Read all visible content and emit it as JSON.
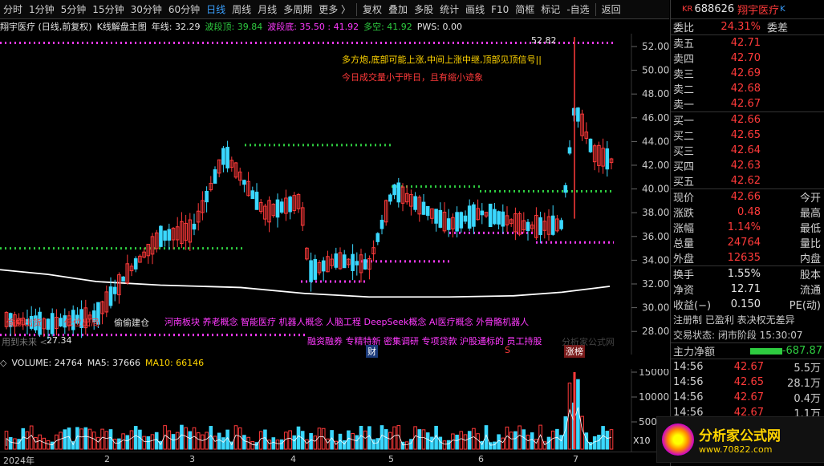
{
  "toolbar": {
    "items": [
      "分时",
      "1分钟",
      "5分钟",
      "15分钟",
      "30分钟",
      "60分钟",
      "日线",
      "周线",
      "月线",
      "多周期",
      "更多 〉",
      "复权",
      "叠加",
      "多股",
      "统计",
      "画线",
      "F10",
      "简框",
      "标记",
      "-自选",
      "返回"
    ]
  },
  "info": {
    "name": "翔宇医疗 (日线,前复权)",
    "indicator": "K线解盘主图",
    "ma_year": "年线: 32.29",
    "wave_top": "波段顶: 39.84",
    "wave_bottom": "波段底: 35.50 : 41.92",
    "longshort": "多空: 41.92",
    "pws": "PWS: 0.00"
  },
  "price_axis": [
    "52.00",
    "50.00",
    "48.00",
    "46.00",
    "44.00",
    "42.00",
    "40.00",
    "38.00",
    "36.00",
    "34.00",
    "32.00",
    "30.00",
    "28.00"
  ],
  "annotations": {
    "peak": "52.82",
    "low": "27.34",
    "signal1": "多方炮,底部可能上涨,中间上涨中继,顶部见顶信号||",
    "signal2": "今日成交量小于昨日，且有缩小迹象",
    "concepts1": "河南板块  养老概念  智能医疗  机器人概念  人脑工程  DeepSeek概念  AI医疗概念  外骨骼机器人",
    "concepts2": "融资融券  专精特新  密集调研  专项贷款  沪股通标的  员工持股",
    "left_tags": "偷偷出货",
    "left_tags2": "低位出局",
    "left_tags3": "偷偷建仓",
    "cai": "财",
    "s": "S",
    "zhangbang": "涨榜",
    "watermark": "用到未来 <",
    "watermark2": "分析家公式网"
  },
  "volume_info": {
    "vol": "VOLUME: 24764",
    "ma5": "MA5: 37666",
    "ma10": "MA10: 66146"
  },
  "vol_axis": [
    "15000",
    "10000",
    "5000"
  ],
  "vol_unit": "X10",
  "date_axis": [
    "2024年",
    "2",
    "3",
    "4",
    "5",
    "6",
    "7"
  ],
  "right_panel": {
    "code": "688626",
    "name": "翔宇医疗",
    "prefix": "KR",
    "suffix": "K",
    "weibi_label": "委比",
    "weibi_value": "24.31%",
    "weicha_label": "委差",
    "asks": [
      {
        "label": "卖五",
        "price": "42.71"
      },
      {
        "label": "卖四",
        "price": "42.70"
      },
      {
        "label": "卖三",
        "price": "42.69"
      },
      {
        "label": "卖二",
        "price": "42.68"
      },
      {
        "label": "卖一",
        "price": "42.67"
      }
    ],
    "bids": [
      {
        "label": "买一",
        "price": "42.66"
      },
      {
        "label": "买二",
        "price": "42.65"
      },
      {
        "label": "买三",
        "price": "42.64"
      },
      {
        "label": "买四",
        "price": "42.63"
      },
      {
        "label": "买五",
        "price": "42.62"
      }
    ],
    "stats": [
      {
        "l": "现价",
        "v": "42.66",
        "r": "今开"
      },
      {
        "l": "涨跌",
        "v": "0.48",
        "r": "最高"
      },
      {
        "l": "涨幅",
        "v": "1.14%",
        "r": "最低"
      },
      {
        "l": "总量",
        "v": "24764",
        "r": "量比"
      },
      {
        "l": "外盘",
        "v": "12635",
        "r": "内盘"
      }
    ],
    "stats2": [
      {
        "l": "换手",
        "v": "1.55%",
        "r": "股本"
      },
      {
        "l": "净资",
        "v": "12.71",
        "r": "流通"
      },
      {
        "l": "收益(−)",
        "v": "0.150",
        "r": "PE(动)"
      }
    ],
    "reg": "注册制  已盈利  表决权无差异",
    "trade_status": "交易状态: 闭市阶段  15:30:07",
    "net_label": "主力净额",
    "net_value": "-687.87",
    "ticks": [
      {
        "t": "14:56",
        "p": "42.67",
        "v": "5.5万"
      },
      {
        "t": "14:56",
        "p": "42.65",
        "v": "28.1万"
      },
      {
        "t": "14:56",
        "p": "42.67",
        "v": "0.4万"
      },
      {
        "t": "14:56",
        "p": "42.67",
        "v": "1.1万"
      }
    ],
    "logo": "分析家公式网",
    "logo_url": "www.70822.com"
  },
  "colors": {
    "up": "#ff3a3a",
    "down": "#3ad8ff",
    "ma": "#ffffff"
  }
}
